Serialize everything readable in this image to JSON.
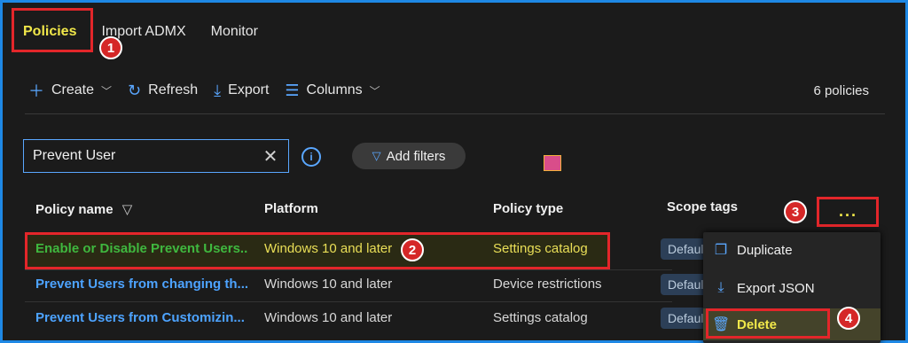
{
  "tabs": [
    {
      "label": "Policies"
    },
    {
      "label": "Import ADMX"
    },
    {
      "label": "Monitor"
    }
  ],
  "toolbar": {
    "create": "Create",
    "refresh": "Refresh",
    "export": "Export",
    "columns": "Columns"
  },
  "count": "6 policies",
  "search": {
    "value": "Prevent User"
  },
  "filters": {
    "label": "Add filters"
  },
  "headers": {
    "name": "Policy name",
    "platform": "Platform",
    "type": "Policy type",
    "scope": "Scope tags"
  },
  "rows": [
    {
      "name": "Enable or Disable Prevent Users...",
      "platform": "Windows 10 and later",
      "type": "Settings catalog",
      "scope": "Default"
    },
    {
      "name": "Prevent Users from changing th...",
      "platform": "Windows 10 and later",
      "type": "Device restrictions",
      "scope": "Default"
    },
    {
      "name": "Prevent Users from Customizin...",
      "platform": "Windows 10 and later",
      "type": "Settings catalog",
      "scope": "Default"
    }
  ],
  "menu": {
    "duplicate": "Duplicate",
    "export_json": "Export JSON",
    "delete": "Delete"
  },
  "steps": [
    "1",
    "2",
    "3",
    "4"
  ],
  "more": "...",
  "icons": {
    "create": "plus-icon",
    "refresh": "refresh-icon",
    "export": "download-icon",
    "columns": "columns-icon",
    "info": "info-icon",
    "filter": "filter-icon",
    "duplicate": "copy-icon",
    "export_json": "download-icon",
    "delete": "trash-icon"
  },
  "colors": {
    "accent": "#1e88e5",
    "annotation": "#e3262a",
    "highlight": "#f1e84a"
  }
}
